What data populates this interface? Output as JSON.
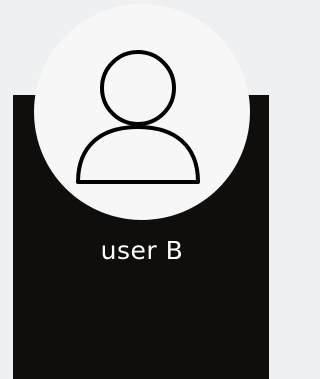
{
  "profile": {
    "username": "user B",
    "avatar_icon": "user-icon"
  },
  "colors": {
    "background": "#eef0f2",
    "card": "#0f0e0d",
    "avatar_background": "#f7f7f7",
    "icon_stroke": "#000000",
    "text": "#ffffff"
  }
}
